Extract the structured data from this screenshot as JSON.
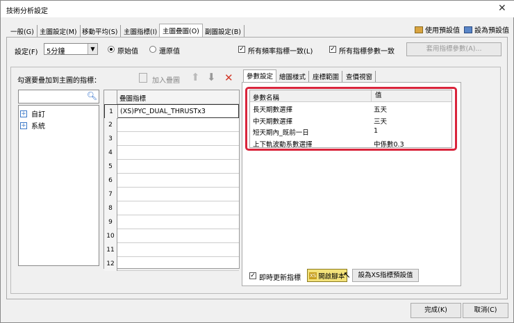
{
  "window": {
    "title": "技術分析設定",
    "close_icon": "close-icon"
  },
  "tabs": [
    {
      "label": "一般(G)"
    },
    {
      "label": "主圖設定(M)"
    },
    {
      "label": "移動平均(S)"
    },
    {
      "label": "主圖指標(I)"
    },
    {
      "label": "主圖疊圖(O)",
      "active": true
    },
    {
      "label": "副圖設定(B)"
    }
  ],
  "toolbar": {
    "use_default": "使用預設值",
    "set_default": "設為預設值"
  },
  "settings": {
    "label": "設定(F)",
    "select_value": "5分鐘",
    "radio_original": "原始值",
    "radio_restored": "還原值",
    "selected_radio": "原始值",
    "chk_all_freq": "所有頻率指標一致(L)",
    "chk_all_params": "所有指標參數一致",
    "apply_button": "套用指標參數(A)..."
  },
  "left": {
    "heading": "勾選要疊加到主圖的指標：",
    "add_overlay": "加入疊圖",
    "search_placeholder": "",
    "tree": [
      {
        "label": "自訂"
      },
      {
        "label": "系統"
      }
    ]
  },
  "grid": {
    "header": "疊圖指標",
    "rows": [
      {
        "n": "1",
        "v": "(XS)PYC_DUAL_THRUSTx3"
      },
      {
        "n": "2",
        "v": ""
      },
      {
        "n": "3",
        "v": ""
      },
      {
        "n": "4",
        "v": ""
      },
      {
        "n": "5",
        "v": ""
      },
      {
        "n": "6",
        "v": ""
      },
      {
        "n": "7",
        "v": ""
      },
      {
        "n": "8",
        "v": ""
      },
      {
        "n": "9",
        "v": ""
      },
      {
        "n": "10",
        "v": ""
      },
      {
        "n": "11",
        "v": ""
      },
      {
        "n": "12",
        "v": ""
      }
    ]
  },
  "right_tabs": [
    {
      "label": "參數設定",
      "active": true
    },
    {
      "label": "繪圖樣式"
    },
    {
      "label": "座標範圍"
    },
    {
      "label": "查價視窗"
    }
  ],
  "params": {
    "col_name": "參數名稱",
    "col_value": "值",
    "rows": [
      {
        "name": "長天期數選擇",
        "value": "五天"
      },
      {
        "name": "中天期數選擇",
        "value": "三天"
      },
      {
        "name": "短天期內_既前一日",
        "value": "1"
      },
      {
        "name": "上下軌波動系數選擇",
        "value": "中係數0.3"
      }
    ]
  },
  "bottom": {
    "realtime_update": "即時更新指標",
    "open_script": "開啟腳本",
    "xs_badge": "XS",
    "set_xs_default": "設為XS指標預設值"
  },
  "footer": {
    "ok": "完成(K)",
    "cancel": "取消(C)"
  },
  "colors": {
    "highlight": "#d9243b",
    "script_button": "#f3e27a"
  }
}
